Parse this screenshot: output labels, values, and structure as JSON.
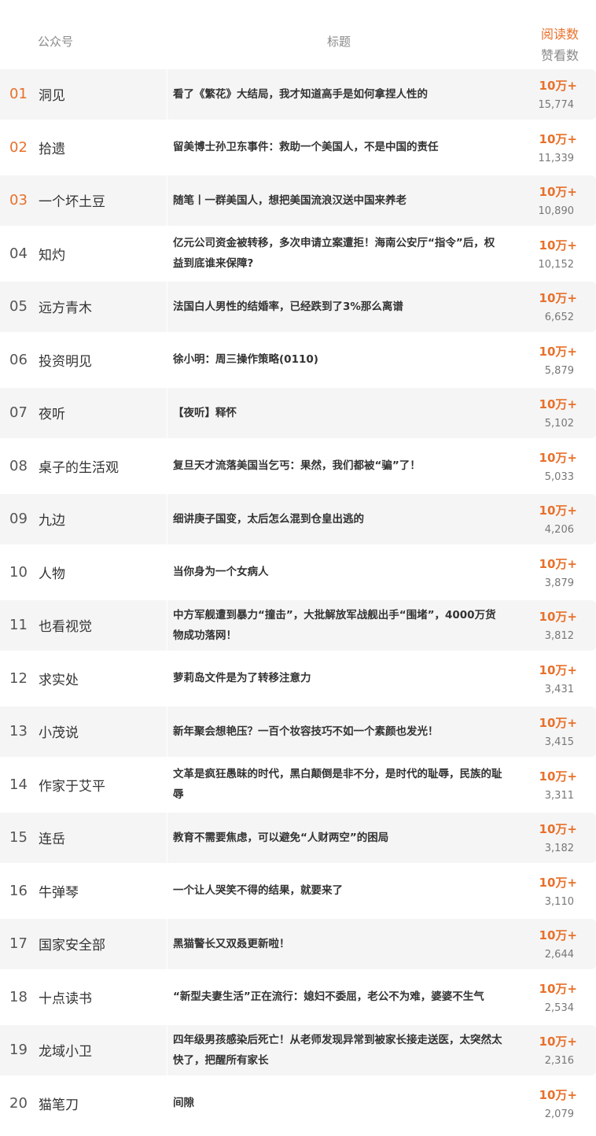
{
  "header": {
    "account": "公众号",
    "title": "标题",
    "reads": "阅读数",
    "likes": "赞看数"
  },
  "rows": [
    {
      "rank": "01",
      "account": "洞见",
      "title": "看了《繁花》大结局，我才知道高手是如何拿捏人性的",
      "reads": "10万+",
      "likes": "15,774"
    },
    {
      "rank": "02",
      "account": "拾遗",
      "title": "留美博士孙卫东事件：救助一个美国人，不是中国的责任",
      "reads": "10万+",
      "likes": "11,339"
    },
    {
      "rank": "03",
      "account": "一个坏土豆",
      "title": "随笔丨一群美国人，想把美国流浪汉送中国来养老",
      "reads": "10万+",
      "likes": "10,890"
    },
    {
      "rank": "04",
      "account": "知灼",
      "title": "亿元公司资金被转移，多次申请立案遭拒！海南公安厅“指令”后，权益到底谁来保障?",
      "reads": "10万+",
      "likes": "10,152"
    },
    {
      "rank": "05",
      "account": "远方青木",
      "title": "法国白人男性的结婚率，已经跌到了3%那么离谱",
      "reads": "10万+",
      "likes": "6,652"
    },
    {
      "rank": "06",
      "account": "投资明见",
      "title": "徐小明：周三操作策略(0110)",
      "reads": "10万+",
      "likes": "5,879"
    },
    {
      "rank": "07",
      "account": "夜听",
      "title": "【夜听】释怀",
      "reads": "10万+",
      "likes": "5,102"
    },
    {
      "rank": "08",
      "account": "桌子的生活观",
      "title": "复旦天才流落美国当乞丐：果然，我们都被“骗”了！",
      "reads": "10万+",
      "likes": "5,033"
    },
    {
      "rank": "09",
      "account": "九边",
      "title": "细讲庚子国变，太后怎么混到仓皇出逃的",
      "reads": "10万+",
      "likes": "4,206"
    },
    {
      "rank": "10",
      "account": "人物",
      "title": "当你身为一个女病人",
      "reads": "10万+",
      "likes": "3,879"
    },
    {
      "rank": "11",
      "account": "也看视觉",
      "title": "中方军舰遭到暴力“撞击”，大批解放军战舰出手“围堵”，4000万货物成功落网！",
      "reads": "10万+",
      "likes": "3,812"
    },
    {
      "rank": "12",
      "account": "求实处",
      "title": "萝莉岛文件是为了转移注意力",
      "reads": "10万+",
      "likes": "3,431"
    },
    {
      "rank": "13",
      "account": "小茂说",
      "title": "新年聚会想艳压？一百个妆容技巧不如一个素颜也发光！",
      "reads": "10万+",
      "likes": "3,415"
    },
    {
      "rank": "14",
      "account": "作家于艾平",
      "title": "文革是疯狂愚昧的时代，黑白颠倒是非不分，是时代的耻辱，民族的耻辱",
      "reads": "10万+",
      "likes": "3,311"
    },
    {
      "rank": "15",
      "account": "连岳",
      "title": "教育不需要焦虑，可以避免“人财两空”的困局",
      "reads": "10万+",
      "likes": "3,182"
    },
    {
      "rank": "16",
      "account": "牛弹琴",
      "title": "一个让人哭笑不得的结果，就要来了",
      "reads": "10万+",
      "likes": "3,110"
    },
    {
      "rank": "17",
      "account": "国家安全部",
      "title": "黑猫警长又双叒更新啦！",
      "reads": "10万+",
      "likes": "2,644"
    },
    {
      "rank": "18",
      "account": "十点读书",
      "title": "“新型夫妻生活”正在流行：媳妇不委屈，老公不为难，婆婆不生气",
      "reads": "10万+",
      "likes": "2,534"
    },
    {
      "rank": "19",
      "account": "龙域小卫",
      "title": "四年级男孩感染后死亡！从老师发现异常到被家长接走送医，太突然太快了，把醒所有家长",
      "reads": "10万+",
      "likes": "2,316"
    },
    {
      "rank": "20",
      "account": "猫笔刀",
      "title": "间隙",
      "reads": "10万+",
      "likes": "2,079"
    }
  ]
}
